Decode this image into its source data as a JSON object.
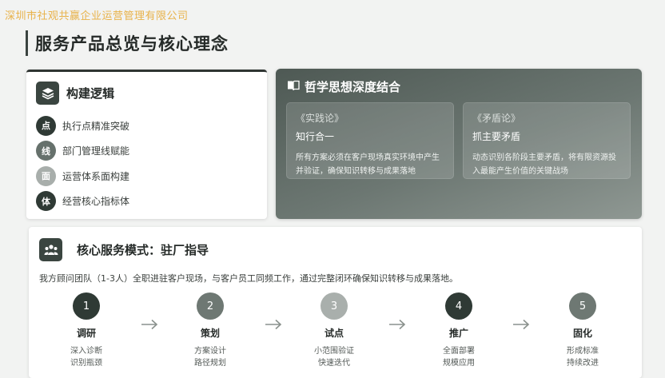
{
  "watermark": "深圳市社观共赢企业运营管理有限公司",
  "page_title": "服务产品总览与核心理念",
  "logic": {
    "title": "构建逻辑",
    "items": [
      {
        "badge": "点",
        "label": "执行点精准突破",
        "color": "#2f3a35"
      },
      {
        "badge": "线",
        "label": "部门管理线赋能",
        "color": "#66716c"
      },
      {
        "badge": "面",
        "label": "运营体系面构建",
        "color": "#a8aeab"
      },
      {
        "badge": "体",
        "label": "经营核心指标体",
        "color": "#2f3a35"
      }
    ]
  },
  "philosophy": {
    "title": "哲学思想深度结合",
    "boxes": [
      {
        "source": "《实践论》",
        "name": "知行合一",
        "desc": "所有方案必须在客户现场真实环境中产生并验证，确保知识转移与成果落地"
      },
      {
        "source": "《矛盾论》",
        "name": "抓主要矛盾",
        "desc": "动态识别各阶段主要矛盾，将有限资源投入最能产生价值的关键战场"
      }
    ]
  },
  "service": {
    "title": "核心服务模式：驻厂指导",
    "intro": "我方顾问团队（1-3人）全职进驻客户现场，与客户员工同频工作，通过完整闭环确保知识转移与成果落地。",
    "steps": [
      {
        "num": "1",
        "title": "调研",
        "desc1": "深入诊断",
        "desc2": "识别瓶颈",
        "color": "#2f3a35"
      },
      {
        "num": "2",
        "title": "策划",
        "desc1": "方案设计",
        "desc2": "路径规划",
        "color": "#6e7873"
      },
      {
        "num": "3",
        "title": "试点",
        "desc1": "小范围验证",
        "desc2": "快速迭代",
        "color": "#a9afac"
      },
      {
        "num": "4",
        "title": "推广",
        "desc1": "全面部署",
        "desc2": "规模应用",
        "color": "#2f3a35"
      },
      {
        "num": "5",
        "title": "固化",
        "desc1": "形成标准",
        "desc2": "持续改进",
        "color": "#6e7873"
      }
    ]
  }
}
